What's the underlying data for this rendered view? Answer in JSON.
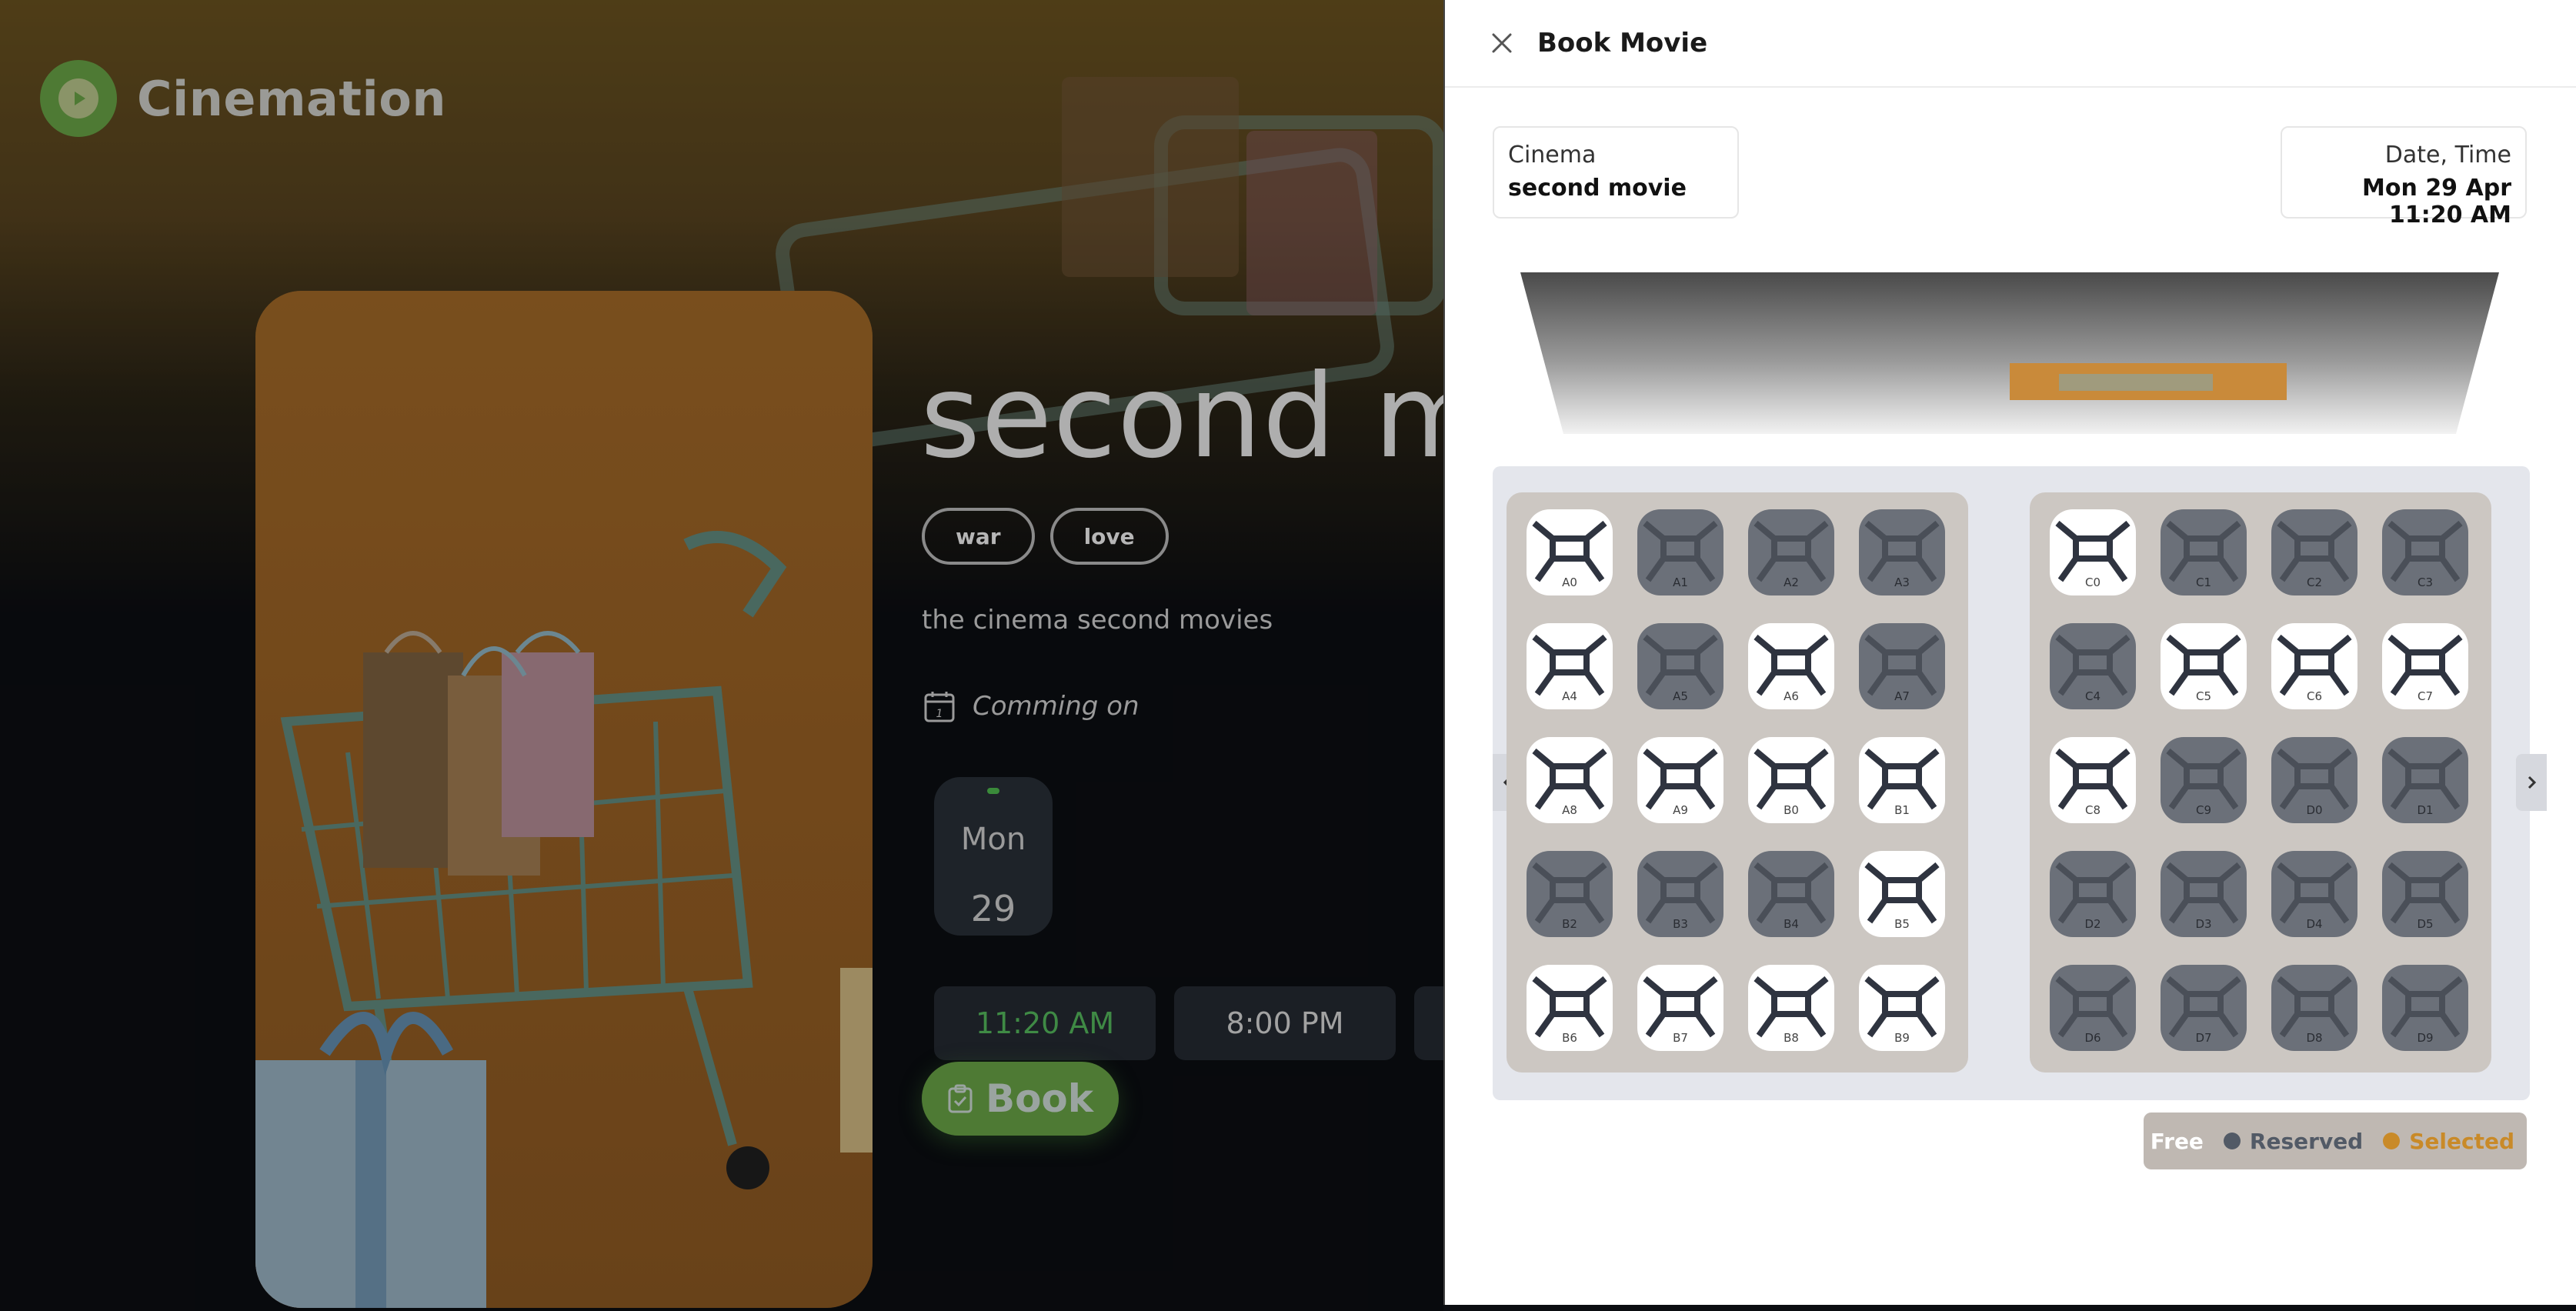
{
  "app": {
    "brand": "Cinemation"
  },
  "movie": {
    "title": "second movie",
    "tags": [
      "war",
      "love"
    ],
    "description": "the cinema second movies",
    "coming_label": "Comming on",
    "day": {
      "name": "Mon",
      "number": "29"
    },
    "times": [
      "11:20 AM",
      "8:00 PM"
    ],
    "book_label": "Book"
  },
  "drawer": {
    "title": "Book Movie",
    "cinema": {
      "label": "Cinema",
      "value": "second movie"
    },
    "datetime": {
      "label": "Date, Time",
      "value": "Mon 29 Apr 11:20 AM"
    }
  },
  "seats": {
    "left": [
      {
        "id": "A0",
        "status": "free"
      },
      {
        "id": "A1",
        "status": "reserved"
      },
      {
        "id": "A2",
        "status": "reserved"
      },
      {
        "id": "A3",
        "status": "reserved"
      },
      {
        "id": "A4",
        "status": "free"
      },
      {
        "id": "A5",
        "status": "reserved"
      },
      {
        "id": "A6",
        "status": "free"
      },
      {
        "id": "A7",
        "status": "reserved"
      },
      {
        "id": "A8",
        "status": "free"
      },
      {
        "id": "A9",
        "status": "free"
      },
      {
        "id": "B0",
        "status": "free"
      },
      {
        "id": "B1",
        "status": "free"
      },
      {
        "id": "B2",
        "status": "reserved"
      },
      {
        "id": "B3",
        "status": "reserved"
      },
      {
        "id": "B4",
        "status": "reserved"
      },
      {
        "id": "B5",
        "status": "free"
      },
      {
        "id": "B6",
        "status": "free"
      },
      {
        "id": "B7",
        "status": "free"
      },
      {
        "id": "B8",
        "status": "free"
      },
      {
        "id": "B9",
        "status": "free"
      }
    ],
    "right": [
      {
        "id": "C0",
        "status": "free"
      },
      {
        "id": "C1",
        "status": "reserved"
      },
      {
        "id": "C2",
        "status": "reserved"
      },
      {
        "id": "C3",
        "status": "reserved"
      },
      {
        "id": "C4",
        "status": "reserved"
      },
      {
        "id": "C5",
        "status": "free"
      },
      {
        "id": "C6",
        "status": "free"
      },
      {
        "id": "C7",
        "status": "free"
      },
      {
        "id": "C8",
        "status": "free"
      },
      {
        "id": "C9",
        "status": "reserved"
      },
      {
        "id": "D0",
        "status": "reserved"
      },
      {
        "id": "D1",
        "status": "reserved"
      },
      {
        "id": "D2",
        "status": "reserved"
      },
      {
        "id": "D3",
        "status": "reserved"
      },
      {
        "id": "D4",
        "status": "reserved"
      },
      {
        "id": "D5",
        "status": "reserved"
      },
      {
        "id": "D6",
        "status": "reserved"
      },
      {
        "id": "D7",
        "status": "reserved"
      },
      {
        "id": "D8",
        "status": "reserved"
      },
      {
        "id": "D9",
        "status": "reserved"
      }
    ]
  },
  "legend": {
    "free": {
      "label": "Free",
      "color": "#ffffff"
    },
    "reserved": {
      "label": "Reserved",
      "color": "#525a66"
    },
    "selected": {
      "label": "Selected",
      "color": "#c98a28"
    }
  },
  "icons": {
    "close": "close-icon",
    "prev": "chevron-left-icon",
    "next": "chevron-right-icon",
    "calendar": "calendar-icon",
    "book": "clipboard-icon",
    "logo": "play-icon"
  }
}
